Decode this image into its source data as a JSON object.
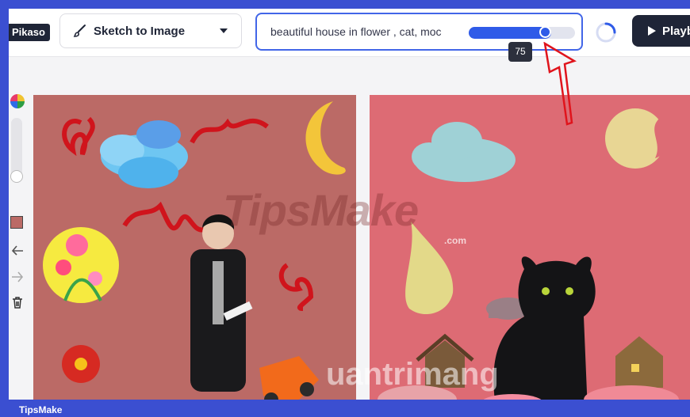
{
  "header": {
    "logo_text": "Pikaso",
    "mode": {
      "label": "Sketch to Image",
      "icon": "brush-icon"
    },
    "prompt": {
      "text": "beautiful house in flower , cat, moc"
    },
    "strength": {
      "value": 75,
      "max": 100,
      "tooltip": "75"
    },
    "play_label": "Playb"
  },
  "toolbar": {
    "items": [
      "color-wheel-icon",
      "brush-size-slider",
      "color-swatch",
      "undo-icon",
      "redo-icon",
      "trash-icon"
    ],
    "swatch_color": "#bb6a66"
  },
  "watermarks": {
    "main": "TipsMake",
    "domain": ".com",
    "secondary": "uantrimang"
  },
  "footer": {
    "text": "TipsMake"
  },
  "colors": {
    "accent": "#2f5be8",
    "dark": "#1f2537",
    "sketch_bg": "#bb6a66",
    "result_bg": "#dd6b74",
    "frame": "#3b4fd1"
  }
}
